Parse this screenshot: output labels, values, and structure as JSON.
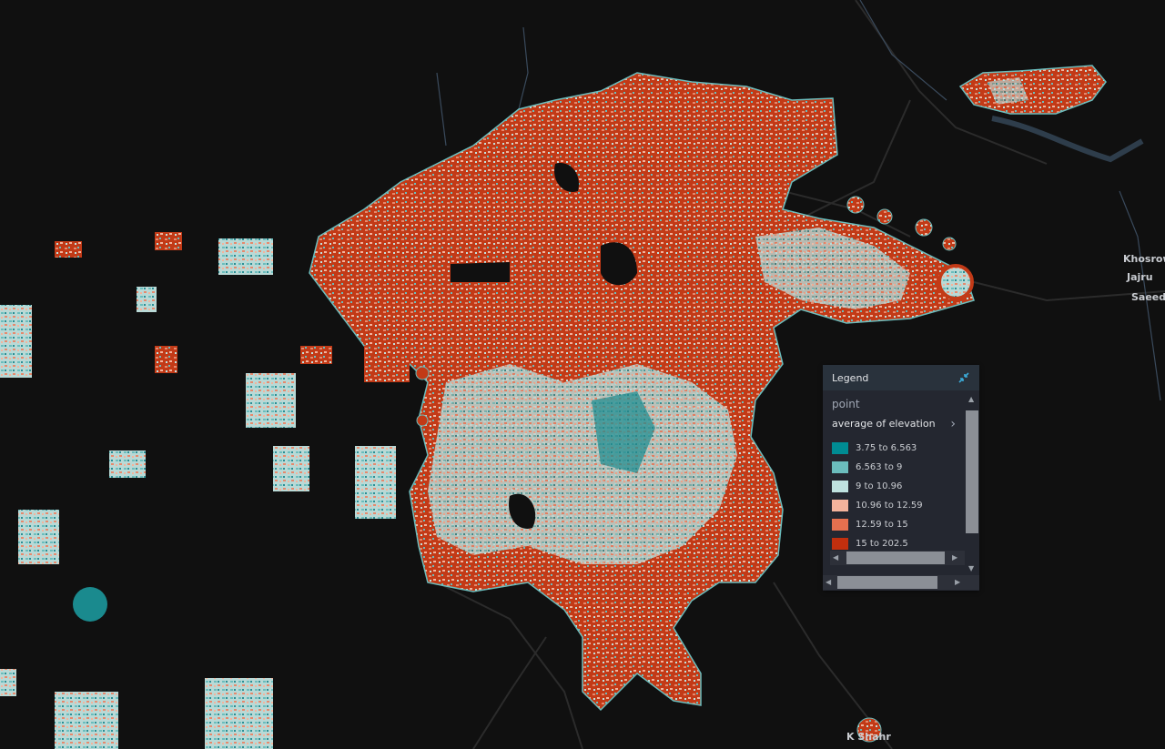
{
  "map": {
    "background_color": "#101010",
    "road_color": "#2b2b2b",
    "water_color": "#3a4a5c",
    "place_labels": [
      "Khosrow",
      "Jajru",
      "Saeeda",
      "K   Shahr"
    ]
  },
  "legend": {
    "title": "Legend",
    "collapse_icon": "collapse-arrows-icon",
    "layer_name": "point",
    "field": "average of elevation",
    "field_chevron": "chevron-right-icon",
    "items": [
      {
        "label": "3.75 to 6.563",
        "color": "#008c93"
      },
      {
        "label": "6.563 to 9",
        "color": "#6bbdbd"
      },
      {
        "label": "9 to 10.96",
        "color": "#bfe2df"
      },
      {
        "label": "10.96 to 12.59",
        "color": "#f3b39c"
      },
      {
        "label": "12.59 to 15",
        "color": "#e5704f"
      },
      {
        "label": "15 to 202.5",
        "color": "#c12f0e"
      }
    ]
  }
}
